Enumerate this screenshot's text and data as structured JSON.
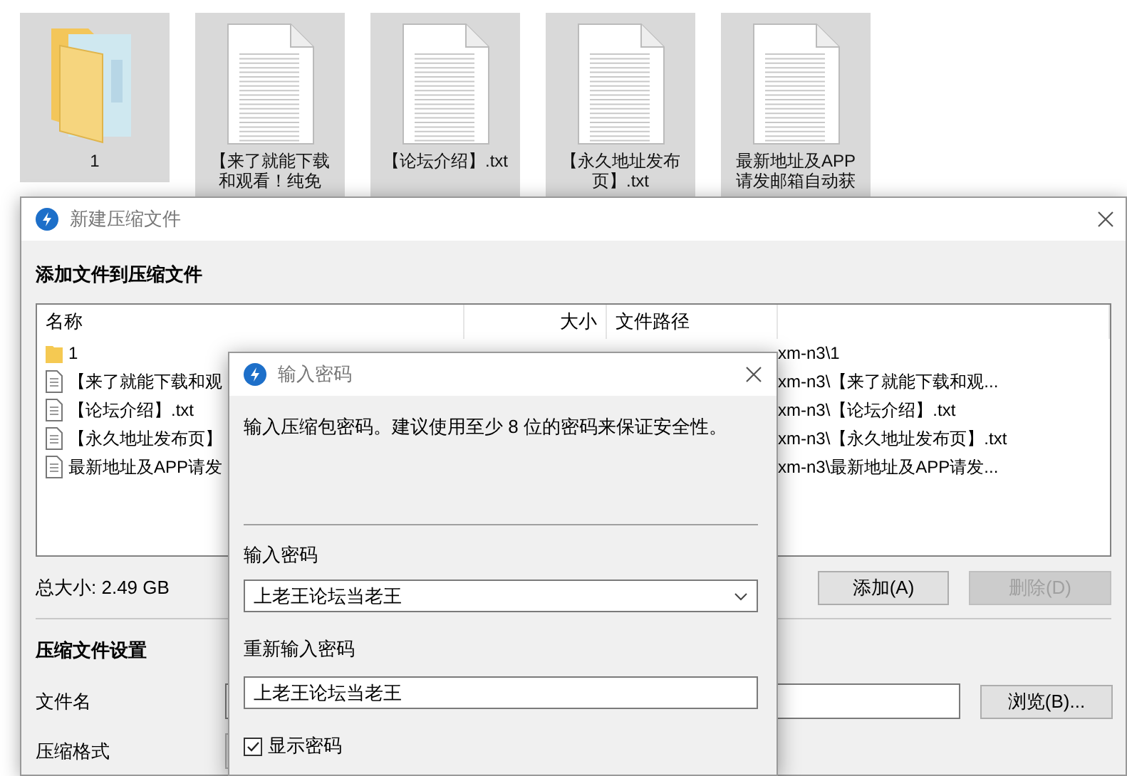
{
  "desktop": {
    "items": [
      {
        "kind": "folder",
        "label_lines": [
          "1"
        ],
        "selected": true
      },
      {
        "kind": "text_file",
        "label_lines": [
          "【来了就能下载",
          "和观看！纯免"
        ],
        "selected": true
      },
      {
        "kind": "text_file",
        "label_lines": [
          "【论坛介绍】.txt"
        ],
        "selected": true
      },
      {
        "kind": "text_file",
        "label_lines": [
          "【永久地址发布",
          "页】.txt"
        ],
        "selected": true
      },
      {
        "kind": "text_file",
        "label_lines": [
          "最新地址及APP",
          "请发邮箱自动获"
        ],
        "selected": true
      }
    ]
  },
  "archive_dialog": {
    "title": "新建压缩文件",
    "section_title": "添加文件到压缩文件",
    "columns": [
      "名称",
      "大小",
      "文件路径"
    ],
    "files": [
      {
        "kind": "folder",
        "name": "1",
        "path": "xm-n3\\1"
      },
      {
        "kind": "text_file",
        "name": "【来了就能下载和观",
        "path": "xm-n3\\【来了就能下载和观..."
      },
      {
        "kind": "text_file",
        "name": "【论坛介绍】.txt",
        "path": "xm-n3\\【论坛介绍】.txt"
      },
      {
        "kind": "text_file",
        "name": "【永久地址发布页】",
        "path": "xm-n3\\【永久地址发布页】.txt"
      },
      {
        "kind": "text_file",
        "name": "最新地址及APP请发",
        "path": "xm-n3\\最新地址及APP请发..."
      }
    ],
    "total_size": "总大小: 2.49 GB",
    "buttons": [
      {
        "label": "添加(A)",
        "disabled": false
      },
      {
        "label": "删除(D)",
        "disabled": true
      }
    ],
    "settings_title": "压缩文件设置",
    "fields": [
      {
        "label": "文件名",
        "kind": "text"
      },
      {
        "label": "压缩格式",
        "kind": "select"
      }
    ],
    "browse_button": "浏览(B)..."
  },
  "password_dialog": {
    "title": "输入密码",
    "message": "输入压缩包密码。建议使用至少 8 位的密码来保证安全性。",
    "password_label": "输入密码",
    "password_value": "上老王论坛当老王",
    "confirm_label": "重新输入密码",
    "confirm_value": "上老王论坛当老王",
    "show_password": {
      "label": "显示密码",
      "checked": true
    }
  }
}
